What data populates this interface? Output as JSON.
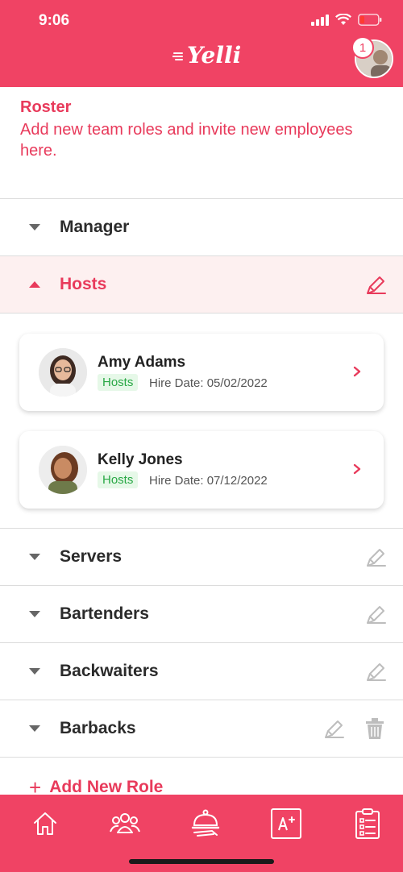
{
  "status_bar": {
    "time": "9:06"
  },
  "header": {
    "logo_text": "Yelli",
    "notification_count": "1"
  },
  "intro": {
    "title": "Roster",
    "description": "Add new team roles and invite new employees here."
  },
  "roles": [
    {
      "label": "Manager"
    },
    {
      "label": "Hosts"
    },
    {
      "label": "Servers"
    },
    {
      "label": "Bartenders"
    },
    {
      "label": "Backwaiters"
    },
    {
      "label": "Barbacks"
    }
  ],
  "employees": [
    {
      "name": "Amy Adams",
      "role_tag": "Hosts",
      "hire_date": "Hire Date: 05/02/2022"
    },
    {
      "name": "Kelly Jones",
      "role_tag": "Hosts",
      "hire_date": "Hire Date: 07/12/2022"
    }
  ],
  "add_role": {
    "label": "Add New Role"
  },
  "tabbar": {
    "icons": [
      "home-icon",
      "team-icon",
      "service-bell-icon",
      "grade-icon",
      "checklist-icon"
    ]
  },
  "colors": {
    "brand": "#f04364",
    "accent_text": "#e83a5b",
    "tag_bg": "#e6f8e8",
    "tag_text": "#29a845",
    "active_row_bg": "#fdf0f0"
  }
}
